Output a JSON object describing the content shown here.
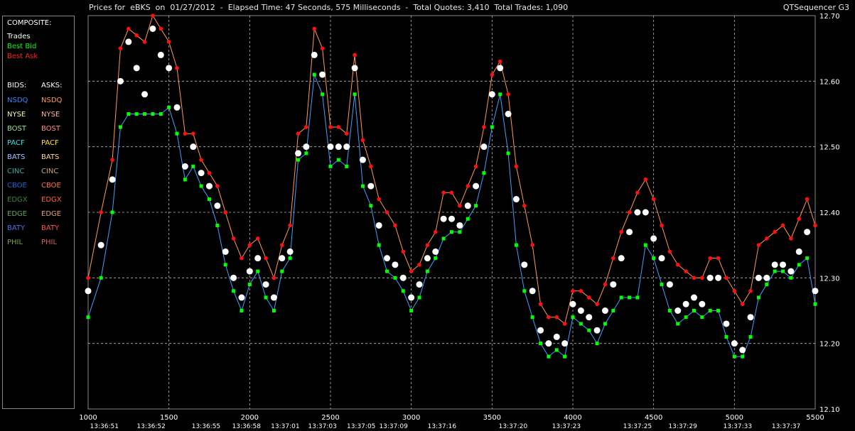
{
  "title": "Prices for  eBKS  on  01/27/2012  -  Elapsed Time: 47 Seconds, 575 Milliseconds  -  Total Quotes: 3,410  Total Trades: 1,090",
  "app_name": "QTSequencer G3",
  "legend": {
    "composite_header": "COMPOSITE:",
    "trades": "Trades",
    "best_bid": "Best Bid",
    "best_ask": "Best Ask",
    "bids_header": "BIDS:",
    "asks_header": "ASKS:",
    "exchanges": [
      {
        "bid": "NSDQ",
        "ask": "NSDQ",
        "bid_color": "#3f7fff",
        "ask_color": "#ff9955"
      },
      {
        "bid": "NYSE",
        "ask": "NYSE",
        "bid_color": "#e8ffb0",
        "ask_color": "#ffb0a0"
      },
      {
        "bid": "BOST",
        "ask": "BOST",
        "bid_color": "#90e890",
        "ask_color": "#ff8c8c"
      },
      {
        "bid": "PACF",
        "ask": "PACF",
        "bid_color": "#40e0e0",
        "ask_color": "#ffe040"
      },
      {
        "bid": "BATS",
        "ask": "BATS",
        "bid_color": "#a0c8ff",
        "ask_color": "#ffd890"
      },
      {
        "bid": "CINC",
        "ask": "CINC",
        "bid_color": "#3ea8a0",
        "ask_color": "#c8a080"
      },
      {
        "bid": "CBOE",
        "ask": "CBOE",
        "bid_color": "#2060d0",
        "ask_color": "#ff7050"
      },
      {
        "bid": "EDGX",
        "ask": "EDGX",
        "bid_color": "#408040",
        "ask_color": "#ff6030"
      },
      {
        "bid": "EDGE",
        "ask": "EDGE",
        "bid_color": "#60a060",
        "ask_color": "#e0a070"
      },
      {
        "bid": "BATY",
        "ask": "BATY",
        "bid_color": "#5070e0",
        "ask_color": "#ff5050"
      },
      {
        "bid": "PHIL",
        "ask": "PHIL",
        "bid_color": "#80a040",
        "ask_color": "#d06060"
      }
    ]
  },
  "colors": {
    "trades": "#ffffff",
    "best_bid": "#00ff00",
    "best_ask": "#ff1010",
    "grid": "#bbbbbb",
    "axis_text": "#ffffff"
  },
  "chart_data": {
    "type": "line",
    "title": "",
    "xlabel": "",
    "ylabel": "",
    "grid": true,
    "y_axis_side": "right",
    "ylim": [
      12.1,
      12.7
    ],
    "xlim": [
      1000,
      5500
    ],
    "y_ticks": [
      "12.70",
      "12.60",
      "12.50",
      "12.40",
      "12.30",
      "12.20",
      "12.10"
    ],
    "y_tick_values": [
      12.7,
      12.6,
      12.5,
      12.4,
      12.3,
      12.2,
      12.1
    ],
    "x_ticks": [
      "1000",
      "1500",
      "2000",
      "2500",
      "3000",
      "3500",
      "4000",
      "4500",
      "5000",
      "5500"
    ],
    "x_tick_values": [
      1000,
      1500,
      2000,
      2500,
      3000,
      3500,
      4000,
      4500,
      5000,
      5500
    ],
    "time_labels": [
      {
        "x": 1100,
        "label": "13:36:51"
      },
      {
        "x": 1390,
        "label": "13:36:52"
      },
      {
        "x": 1730,
        "label": "13:36:55"
      },
      {
        "x": 1980,
        "label": "13:36:58"
      },
      {
        "x": 2220,
        "label": "13:37:01"
      },
      {
        "x": 2450,
        "label": "13:37:03"
      },
      {
        "x": 2690,
        "label": "13:37:05"
      },
      {
        "x": 2890,
        "label": "13:37:09"
      },
      {
        "x": 3190,
        "label": "13:37:16"
      },
      {
        "x": 3630,
        "label": "13:37:20"
      },
      {
        "x": 3960,
        "label": "13:37:23"
      },
      {
        "x": 4400,
        "label": "13:37:25"
      },
      {
        "x": 4680,
        "label": "13:37:29"
      },
      {
        "x": 5020,
        "label": "13:37:33"
      },
      {
        "x": 5320,
        "label": "13:37:37"
      }
    ],
    "series": [
      {
        "name": "Trades",
        "x": [
          1000,
          1080,
          1150,
          1200,
          1250,
          1300,
          1350,
          1400,
          1450,
          1500,
          1550,
          1600,
          1650,
          1700,
          1750,
          1800,
          1850,
          1900,
          1950,
          2000,
          2050,
          2100,
          2150,
          2200,
          2250,
          2300,
          2350,
          2400,
          2450,
          2500,
          2550,
          2600,
          2650,
          2700,
          2750,
          2800,
          2850,
          2900,
          2950,
          3000,
          3050,
          3100,
          3150,
          3200,
          3250,
          3300,
          3350,
          3400,
          3450,
          3500,
          3550,
          3600,
          3650,
          3700,
          3750,
          3800,
          3850,
          3900,
          3950,
          4000,
          4050,
          4100,
          4150,
          4200,
          4250,
          4300,
          4350,
          4400,
          4450,
          4500,
          4550,
          4600,
          4650,
          4700,
          4750,
          4800,
          4850,
          4900,
          4950,
          5000,
          5050,
          5100,
          5150,
          5200,
          5250,
          5300,
          5350,
          5400,
          5450,
          5500
        ],
        "values": [
          12.28,
          12.35,
          12.45,
          12.6,
          12.66,
          12.62,
          12.58,
          12.68,
          12.64,
          12.62,
          12.56,
          12.47,
          12.5,
          12.46,
          12.44,
          12.41,
          12.34,
          12.3,
          12.27,
          12.31,
          12.33,
          12.29,
          12.27,
          12.33,
          12.34,
          12.49,
          12.5,
          12.64,
          12.61,
          12.5,
          12.5,
          12.5,
          12.62,
          12.48,
          12.44,
          12.38,
          12.33,
          12.32,
          12.3,
          12.27,
          12.29,
          12.33,
          12.34,
          12.39,
          12.39,
          12.38,
          12.41,
          12.44,
          12.5,
          12.58,
          12.62,
          12.55,
          12.42,
          12.32,
          12.28,
          12.22,
          12.2,
          12.21,
          12.2,
          12.26,
          12.25,
          12.24,
          12.22,
          12.25,
          12.29,
          12.33,
          12.37,
          12.4,
          12.4,
          12.36,
          12.33,
          12.29,
          12.25,
          12.26,
          12.27,
          12.26,
          12.3,
          12.3,
          12.23,
          12.2,
          12.19,
          12.24,
          12.3,
          12.3,
          12.32,
          12.32,
          12.31,
          12.34,
          12.37,
          12.28
        ]
      },
      {
        "name": "Best Bid",
        "x": [
          1000,
          1080,
          1150,
          1200,
          1250,
          1300,
          1350,
          1400,
          1450,
          1500,
          1550,
          1600,
          1650,
          1700,
          1750,
          1800,
          1850,
          1900,
          1950,
          2000,
          2050,
          2100,
          2150,
          2200,
          2250,
          2300,
          2350,
          2400,
          2450,
          2500,
          2550,
          2600,
          2650,
          2700,
          2750,
          2800,
          2850,
          2900,
          2950,
          3000,
          3050,
          3100,
          3150,
          3200,
          3250,
          3300,
          3350,
          3400,
          3450,
          3500,
          3550,
          3600,
          3650,
          3700,
          3750,
          3800,
          3850,
          3900,
          3950,
          4000,
          4050,
          4100,
          4150,
          4200,
          4250,
          4300,
          4350,
          4400,
          4450,
          4500,
          4550,
          4600,
          4650,
          4700,
          4750,
          4800,
          4850,
          4900,
          4950,
          5000,
          5050,
          5100,
          5150,
          5200,
          5250,
          5300,
          5350,
          5400,
          5450,
          5500
        ],
        "values": [
          12.24,
          12.3,
          12.4,
          12.53,
          12.55,
          12.55,
          12.55,
          12.55,
          12.55,
          12.56,
          12.52,
          12.45,
          12.47,
          12.44,
          12.42,
          12.38,
          12.32,
          12.28,
          12.25,
          12.29,
          12.31,
          12.27,
          12.25,
          12.31,
          12.33,
          12.48,
          12.49,
          12.61,
          12.58,
          12.47,
          12.48,
          12.47,
          12.58,
          12.44,
          12.41,
          12.35,
          12.31,
          12.3,
          12.28,
          12.25,
          12.27,
          12.31,
          12.33,
          12.36,
          12.37,
          12.37,
          12.39,
          12.41,
          12.46,
          12.53,
          12.58,
          12.49,
          12.35,
          12.28,
          12.24,
          12.2,
          12.18,
          12.19,
          12.18,
          12.24,
          12.23,
          12.22,
          12.2,
          12.23,
          12.25,
          12.27,
          12.27,
          12.27,
          12.35,
          12.33,
          12.29,
          12.25,
          12.23,
          12.24,
          12.25,
          12.24,
          12.25,
          12.25,
          12.21,
          12.18,
          12.18,
          12.21,
          12.27,
          12.29,
          12.31,
          12.31,
          12.3,
          12.32,
          12.33,
          12.26
        ]
      },
      {
        "name": "Best Ask",
        "x": [
          1000,
          1080,
          1150,
          1200,
          1250,
          1300,
          1350,
          1400,
          1450,
          1500,
          1550,
          1600,
          1650,
          1700,
          1750,
          1800,
          1850,
          1900,
          1950,
          2000,
          2050,
          2100,
          2150,
          2200,
          2250,
          2300,
          2350,
          2400,
          2450,
          2500,
          2550,
          2600,
          2650,
          2700,
          2750,
          2800,
          2850,
          2900,
          2950,
          3000,
          3050,
          3100,
          3150,
          3200,
          3250,
          3300,
          3350,
          3400,
          3450,
          3500,
          3550,
          3600,
          3650,
          3700,
          3750,
          3800,
          3850,
          3900,
          3950,
          4000,
          4050,
          4100,
          4150,
          4200,
          4250,
          4300,
          4350,
          4400,
          4450,
          4500,
          4550,
          4600,
          4650,
          4700,
          4750,
          4800,
          4850,
          4900,
          4950,
          5000,
          5050,
          5100,
          5150,
          5200,
          5250,
          5300,
          5350,
          5400,
          5450,
          5500
        ],
        "values": [
          12.3,
          12.4,
          12.48,
          12.65,
          12.68,
          12.67,
          12.66,
          12.7,
          12.68,
          12.66,
          12.62,
          12.52,
          12.52,
          12.48,
          12.46,
          12.44,
          12.4,
          12.36,
          12.33,
          12.35,
          12.36,
          12.33,
          12.3,
          12.35,
          12.38,
          12.52,
          12.53,
          12.68,
          12.65,
          12.53,
          12.53,
          12.52,
          12.64,
          12.51,
          12.47,
          12.42,
          12.4,
          12.38,
          12.34,
          12.31,
          12.32,
          12.35,
          12.37,
          12.43,
          12.43,
          12.41,
          12.44,
          12.47,
          12.53,
          12.61,
          12.63,
          12.58,
          12.47,
          12.41,
          12.35,
          12.26,
          12.24,
          12.24,
          12.23,
          12.28,
          12.28,
          12.27,
          12.26,
          12.29,
          12.33,
          12.37,
          12.4,
          12.43,
          12.45,
          12.42,
          12.38,
          12.34,
          12.32,
          12.31,
          12.3,
          12.3,
          12.33,
          12.33,
          12.3,
          12.28,
          12.26,
          12.28,
          12.35,
          12.36,
          12.37,
          12.38,
          12.36,
          12.39,
          12.42,
          12.38
        ]
      }
    ]
  }
}
